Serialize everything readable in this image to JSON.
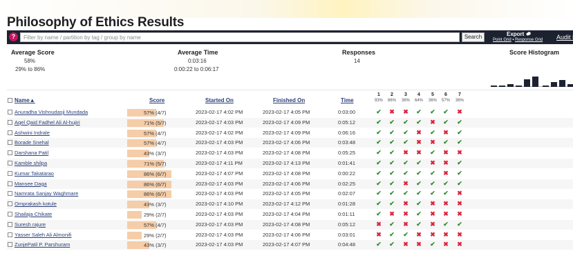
{
  "page": {
    "title": "Philosophy of Ethics Results"
  },
  "toolbar": {
    "help_icon": "?",
    "filter_placeholder": "Filter by name / partition by tag / group by name",
    "search_label": "Search",
    "export_label": "Export",
    "point_grid_label": "Point Grid",
    "separator": "•",
    "response_grid_label": "Response Grid",
    "audit_label": "Audit Lo"
  },
  "stats": {
    "average_score": {
      "label": "Average Score",
      "value": "58%",
      "range": "29% to 86%"
    },
    "average_time": {
      "label": "Average Time",
      "value": "0:03:16",
      "range": "0:00:22 to 0:06:17"
    },
    "responses": {
      "label": "Responses",
      "value": "14"
    },
    "histogram": {
      "label": "Score Histogram",
      "relative_heights": [
        0.12,
        0.12,
        0.22,
        0.12,
        0.6,
        0.85,
        0.12,
        0.4,
        0.55,
        0.2
      ]
    }
  },
  "columns": {
    "name": "Name▲",
    "score": "Score",
    "started": "Started On",
    "finished": "Finished On",
    "time": "Time"
  },
  "questions": [
    {
      "num": "1",
      "pct": "93%"
    },
    {
      "num": "2",
      "pct": "86%"
    },
    {
      "num": "3",
      "pct": "36%"
    },
    {
      "num": "4",
      "pct": "64%"
    },
    {
      "num": "5",
      "pct": "36%"
    },
    {
      "num": "6",
      "pct": "57%"
    },
    {
      "num": "7",
      "pct": "36%"
    }
  ],
  "marks": {
    "correct": "✔",
    "wrong": "✖"
  },
  "rows": [
    {
      "name": "Anuradha Vishnudasji Mundada",
      "score": "57% (4/7)",
      "score_frac": 0.57,
      "started": "2023-02-17 4:02 PM",
      "finished": "2023-02-17 4:05 PM",
      "time": "0:03:00",
      "answers": [
        1,
        0,
        0,
        1,
        1,
        1,
        0
      ]
    },
    {
      "name": "Aqel Qaid Fadhel Ali Al-hujiri",
      "score": "71% (5/7)",
      "score_frac": 0.71,
      "started": "2023-02-17 4:03 PM",
      "finished": "2023-02-17 4:09 PM",
      "time": "0:05:12",
      "answers": [
        1,
        1,
        1,
        1,
        0,
        1,
        1
      ]
    },
    {
      "name": "Ashwini Indrale",
      "score": "57% (4/7)",
      "score_frac": 0.57,
      "started": "2023-02-17 4:02 PM",
      "finished": "2023-02-17 4:09 PM",
      "time": "0:06:16",
      "answers": [
        1,
        1,
        1,
        0,
        1,
        0,
        1
      ]
    },
    {
      "name": "Borade Snehal",
      "score": "57% (4/7)",
      "score_frac": 0.57,
      "started": "2023-02-17 4:03 PM",
      "finished": "2023-02-17 4:06 PM",
      "time": "0:03:48",
      "answers": [
        1,
        1,
        1,
        0,
        0,
        1,
        1
      ]
    },
    {
      "name": "Darshana Patil",
      "score": "43% (3/7)",
      "score_frac": 0.43,
      "started": "2023-02-17 4:03 PM",
      "finished": "2023-02-17 4:08 PM",
      "time": "0:05:25",
      "answers": [
        1,
        1,
        0,
        0,
        1,
        0,
        0
      ]
    },
    {
      "name": "Kamble shilpa",
      "score": "71% (5/7)",
      "score_frac": 0.71,
      "started": "2023-02-17 4:11 PM",
      "finished": "2023-02-17 4:13 PM",
      "time": "0:01:41",
      "answers": [
        1,
        1,
        1,
        1,
        0,
        0,
        1
      ]
    },
    {
      "name": "Kumar Takatarao",
      "score": "86% (6/7)",
      "score_frac": 0.86,
      "started": "2023-02-17 4:07 PM",
      "finished": "2023-02-17 4:08 PM",
      "time": "0:00:22",
      "answers": [
        1,
        1,
        1,
        1,
        1,
        0,
        1
      ]
    },
    {
      "name": "Mansee Daga",
      "score": "86% (6/7)",
      "score_frac": 0.86,
      "started": "2023-02-17 4:03 PM",
      "finished": "2023-02-17 4:06 PM",
      "time": "0:02:25",
      "answers": [
        1,
        1,
        0,
        1,
        1,
        1,
        1
      ]
    },
    {
      "name": "Namrata Sanjay Waghmare",
      "score": "86% (6/7)",
      "score_frac": 0.86,
      "started": "2023-02-17 4:03 PM",
      "finished": "2023-02-17 4:05 PM",
      "time": "0:02:07",
      "answers": [
        1,
        1,
        1,
        1,
        1,
        1,
        0
      ]
    },
    {
      "name": "Omprakash kotule",
      "score": "43% (3/7)",
      "score_frac": 0.43,
      "started": "2023-02-17 4:10 PM",
      "finished": "2023-02-17 4:12 PM",
      "time": "0:01:28",
      "answers": [
        1,
        1,
        0,
        1,
        0,
        0,
        0
      ]
    },
    {
      "name": "Shailaja Chikate",
      "score": "29% (2/7)",
      "score_frac": 0.29,
      "started": "2023-02-17 4:03 PM",
      "finished": "2023-02-17 4:04 PM",
      "time": "0:01:11",
      "answers": [
        1,
        0,
        0,
        1,
        0,
        0,
        0
      ]
    },
    {
      "name": "Suresh rajure",
      "score": "57% (4/7)",
      "score_frac": 0.57,
      "started": "2023-02-17 4:03 PM",
      "finished": "2023-02-17 4:08 PM",
      "time": "0:05:12",
      "answers": [
        0,
        1,
        0,
        1,
        0,
        1,
        1
      ]
    },
    {
      "name": "Yasser Saleh Ali Almonifi",
      "score": "29% (2/7)",
      "score_frac": 0.29,
      "started": "2023-02-17 4:03 PM",
      "finished": "2023-02-17 4:06 PM",
      "time": "0:03:01",
      "answers": [
        0,
        1,
        1,
        0,
        0,
        0,
        0
      ]
    },
    {
      "name": "ZunjePatil P. Parshuram",
      "score": "43% (3/7)",
      "score_frac": 0.43,
      "started": "2023-02-17 4:03 PM",
      "finished": "2023-02-17 4:07 PM",
      "time": "0:04:48",
      "answers": [
        1,
        1,
        0,
        0,
        1,
        0,
        0
      ]
    }
  ]
}
